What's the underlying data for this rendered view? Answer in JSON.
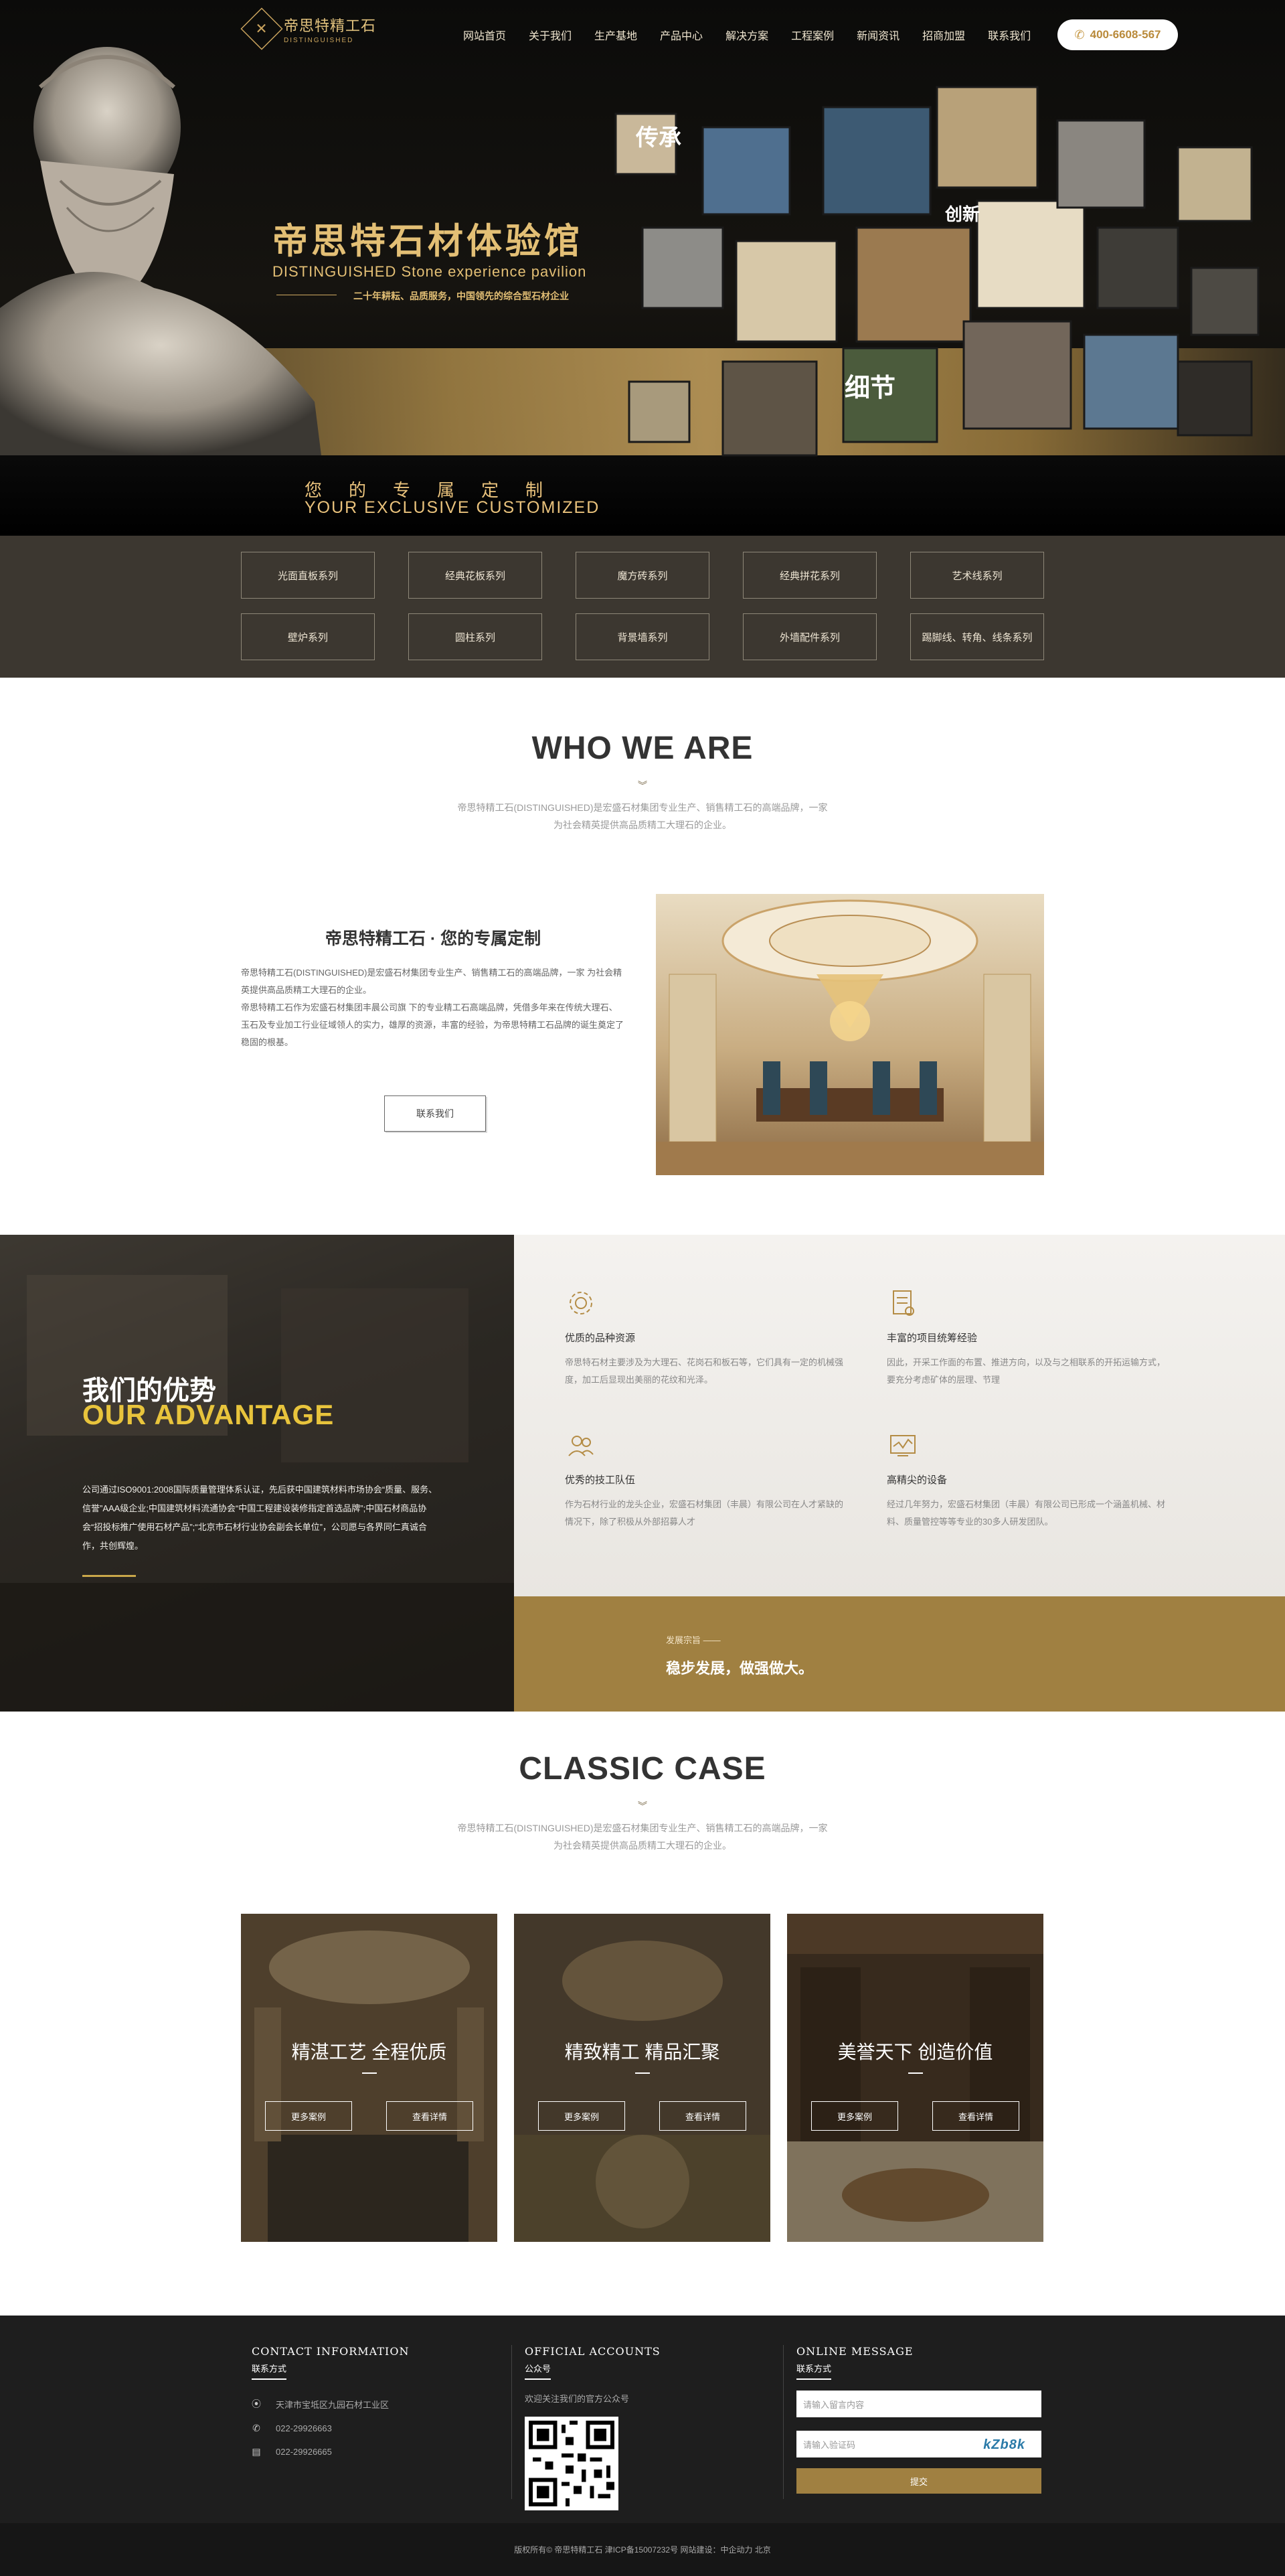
{
  "header": {
    "logo_cn": "帝思特精工石",
    "logo_en": "DISTINGUISHED",
    "nav": [
      "网站首页",
      "关于我们",
      "生产基地",
      "产品中心",
      "解决方案",
      "工程案例",
      "新闻资讯",
      "招商加盟",
      "联系我们"
    ],
    "phone": "400-6608-567"
  },
  "banner": {
    "title": "帝思特石材体验馆",
    "subtitle": "DISTINGUISHED Stone experience pavilion",
    "slogan": "二十年耕耘、品质服务，中国领先的综合型石材企业",
    "custom_cn": "您的专属定制",
    "custom_en": "YOUR EXCLUSIVE CUSTOMIZED",
    "cube_labels": [
      "传承",
      "创新",
      "细节"
    ]
  },
  "categories": [
    "光面直板系列",
    "经典花板系列",
    "魔方砖系列",
    "经典拼花系列",
    "艺术线系列",
    "壁炉系列",
    "圆柱系列",
    "背景墙系列",
    "外墙配件系列",
    "踢脚线、转角、线条系列"
  ],
  "who": {
    "title": "WHO WE ARE",
    "deco": "︾",
    "intro": "帝思特精工石(DISTINGUISHED)是宏盛石材集团专业生产、销售精工石的高端品牌，一家为社会精英提供高品质精工大理石的企业。",
    "heading": "帝思特精工石 · 您的专属定制",
    "para1": "帝思特精工石(DISTINGUISHED)是宏盛石材集团专业生产、销售精工石的高端品牌，一家 为社会精英提供高品质精工大理石的企业。",
    "para2": "帝思特精工石作为宏盛石材集团丰晨公司旗 下的专业精工石高端品牌，凭借多年来在传统大理石、玉石及专业加工行业征域领人的实力，雄厚的资源，丰富的经验，为帝思特精工石品牌的诞生奠定了稳固的根基。",
    "button": "联系我们"
  },
  "advantage": {
    "title_cn": "我们的优势",
    "title_en": "OUR ADVANTAGE",
    "para": "公司通过ISO9001:2008国际质量管理体系认证，先后获中国建筑材料市场协会“质量、服务、信誉”AAA级企业;中国建筑材料流通协会“中国工程建设装修指定首选品牌”;中国石材商品协会“招投标推广使用石材产品”;“北京市石材行业协会副会长单位”，公司愿与各界同仁真诚合作，共创辉煌。",
    "items": [
      {
        "icon": "gear-icon",
        "title": "优质的品种资源",
        "desc": "帝思特石材主要涉及为大理石、花岗石和板石等，它们具有一定的机械强度，加工后显现出美丽的花纹和光泽。"
      },
      {
        "icon": "document-icon",
        "title": "丰富的项目统筹经验",
        "desc": "因此，开采工作面的布置、推进方向，以及与之相联系的开拓运输方式，要充分考虑矿体的层理、节理"
      },
      {
        "icon": "team-icon",
        "title": "优秀的技工队伍",
        "desc": "作为石材行业的龙头企业，宏盛石材集团（丰晨）有限公司在人才紧缺的情况下，除了积极从外部招募人才"
      },
      {
        "icon": "equipment-icon",
        "title": "高精尖的设备",
        "desc": "经过几年努力，宏盛石材集团（丰晨）有限公司已形成一个涵盖机械、材料、质量管控等等专业的30多人研发团队。"
      }
    ],
    "gold_small": "发展宗旨 ——",
    "gold_big": "稳步发展，做强做大。"
  },
  "case": {
    "title": "CLASSIC CASE",
    "deco": "︾",
    "intro": "帝思特精工石(DISTINGUISHED)是宏盛石材集团专业生产、销售精工石的高端品牌，一家为社会精英提供高品质精工大理石的企业。",
    "items": [
      {
        "title": "精湛工艺 全程优质",
        "more": "更多案例",
        "detail": "查看详情"
      },
      {
        "title": "精致精工 精品汇聚",
        "more": "更多案例",
        "detail": "查看详情"
      },
      {
        "title": "美誉天下 创造价值",
        "more": "更多案例",
        "detail": "查看详情"
      }
    ]
  },
  "footer": {
    "contact_title": "CONTACT INFORMATION",
    "contact_sub": "联系方式",
    "address": "天津市宝坻区九园石材工业区",
    "tel": "022-29926663",
    "fax": "022-29926665",
    "accounts_title": "OFFICIAL ACCOUNTS",
    "accounts_sub": "公众号",
    "accounts_note": "欢迎关注我们的官方公众号",
    "message_title": "ONLINE MESSAGE",
    "message_sub": "联系方式",
    "msg_placeholder": "请输入留言内容",
    "code_placeholder": "请输入验证码",
    "captcha": "kZb8k",
    "submit": "提交",
    "copyright": "版权所有© 帝思特精工石  津ICP备15007232号  网站建设：中企动力 北京"
  }
}
